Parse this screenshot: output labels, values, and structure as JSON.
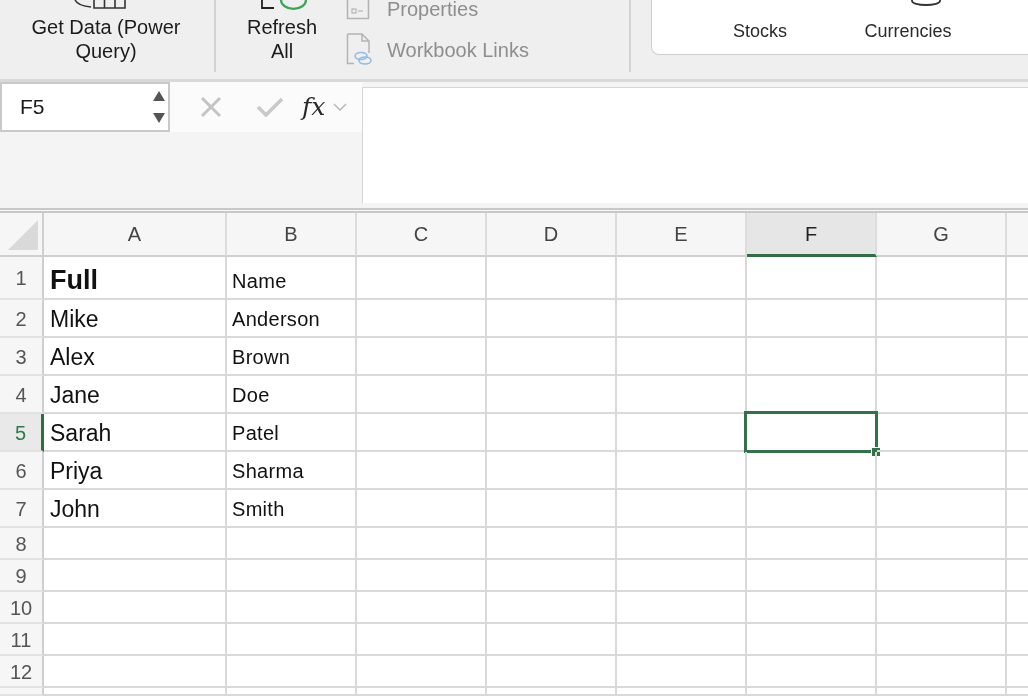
{
  "ribbon": {
    "get_data": {
      "label": "Get Data (Power Query)"
    },
    "refresh_all": {
      "label": "Refresh All"
    },
    "query_tools": [
      {
        "label": "Properties",
        "disabled": true
      },
      {
        "label": "Workbook Links",
        "disabled": true
      }
    ],
    "data_types": [
      {
        "label": "Stocks"
      },
      {
        "label": "Currencies"
      }
    ]
  },
  "formula_bar": {
    "name_box": "F5",
    "function_label": "fx"
  },
  "sheet": {
    "columns": [
      {
        "label": "A",
        "selected": false
      },
      {
        "label": "B",
        "selected": false
      },
      {
        "label": "C",
        "selected": false
      },
      {
        "label": "D",
        "selected": false
      },
      {
        "label": "E",
        "selected": false
      },
      {
        "label": "F",
        "selected": true
      },
      {
        "label": "G",
        "selected": false
      }
    ],
    "rows": [
      {
        "label": "1",
        "selected": false,
        "cells": [
          {
            "text": "Full",
            "bold": true
          },
          {
            "text": "Name",
            "bold": false
          }
        ]
      },
      {
        "label": "2",
        "selected": false,
        "cells": [
          {
            "text": "Mike",
            "bold": false
          },
          {
            "text": "Anderson",
            "bold": false
          }
        ]
      },
      {
        "label": "3",
        "selected": false,
        "cells": [
          {
            "text": "Alex",
            "bold": false
          },
          {
            "text": "Brown",
            "bold": false
          }
        ]
      },
      {
        "label": "4",
        "selected": false,
        "cells": [
          {
            "text": "Jane",
            "bold": false
          },
          {
            "text": "Doe",
            "bold": false
          }
        ]
      },
      {
        "label": "5",
        "selected": true,
        "cells": [
          {
            "text": "Sarah",
            "bold": false
          },
          {
            "text": "Patel",
            "bold": false
          }
        ]
      },
      {
        "label": "6",
        "selected": false,
        "cells": [
          {
            "text": "Priya",
            "bold": false
          },
          {
            "text": "Sharma",
            "bold": false
          }
        ]
      },
      {
        "label": "7",
        "selected": false,
        "cells": [
          {
            "text": "John",
            "bold": false
          },
          {
            "text": "Smith",
            "bold": false
          }
        ]
      },
      {
        "label": "8",
        "selected": false
      },
      {
        "label": "9",
        "selected": false
      },
      {
        "label": "10",
        "selected": false
      },
      {
        "label": "11",
        "selected": false
      },
      {
        "label": "12",
        "selected": false
      }
    ]
  }
}
